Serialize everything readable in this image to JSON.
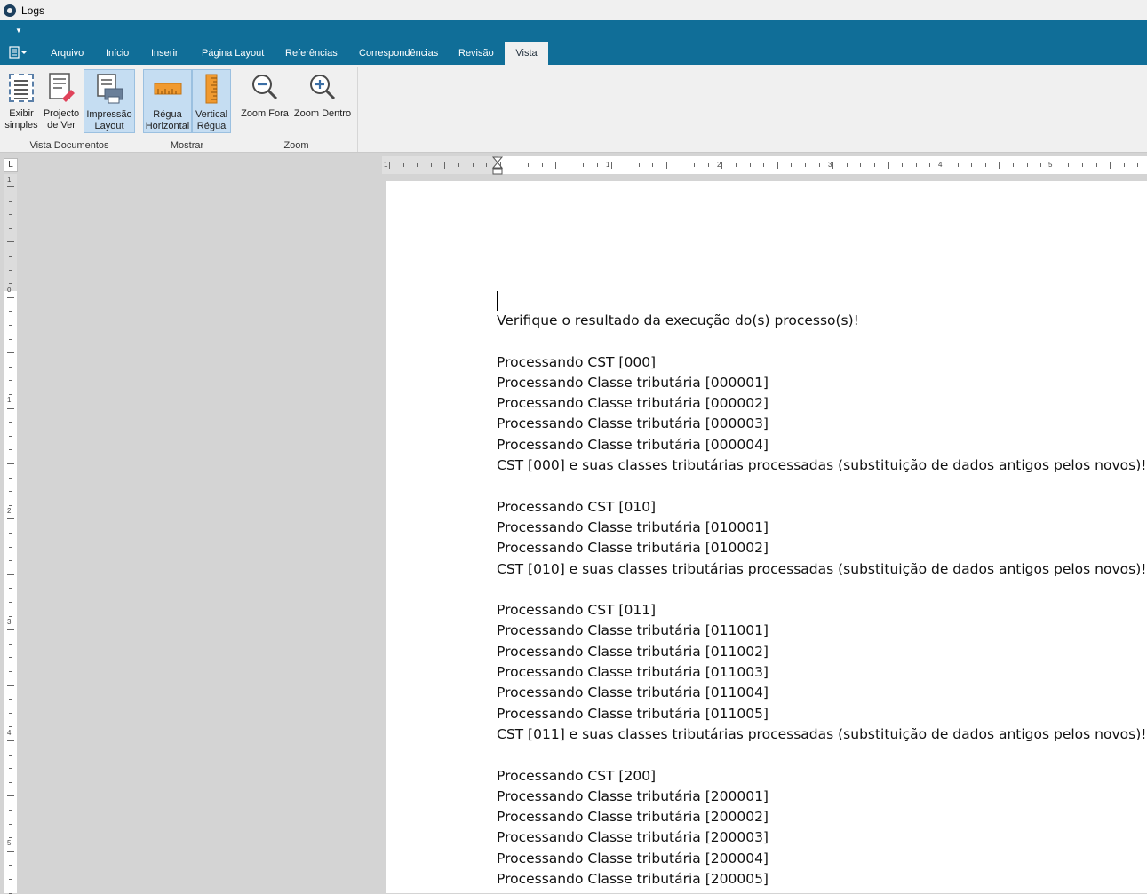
{
  "window": {
    "title": "Logs"
  },
  "ribbon": {
    "file_menu_icon": "document-menu-icon",
    "tabs": [
      {
        "label": "Arquivo",
        "active": false
      },
      {
        "label": "Início",
        "active": false
      },
      {
        "label": "Inserir",
        "active": false
      },
      {
        "label": "Página Layout",
        "active": false
      },
      {
        "label": "Referências",
        "active": false
      },
      {
        "label": "Correspondências",
        "active": false
      },
      {
        "label": "Revisão",
        "active": false
      },
      {
        "label": "Vista",
        "active": true
      }
    ],
    "groups": {
      "vista_documentos": {
        "label": "Vista Documentos",
        "buttons": [
          {
            "line1": "Exibir",
            "line2": "simples",
            "icon": "simple-view-icon",
            "pressed": false
          },
          {
            "line1": "Projecto",
            "line2": "de Ver",
            "icon": "draft-view-icon",
            "pressed": false
          },
          {
            "line1": "Impressão",
            "line2": "Layout",
            "icon": "print-layout-icon",
            "pressed": true
          }
        ]
      },
      "mostrar": {
        "label": "Mostrar",
        "buttons": [
          {
            "line1": "Régua",
            "line2": "Horizontal",
            "icon": "horizontal-ruler-icon",
            "pressed": true
          },
          {
            "line1": "Vertical",
            "line2": "Régua",
            "icon": "vertical-ruler-icon",
            "pressed": true
          }
        ]
      },
      "zoom": {
        "label": "Zoom",
        "buttons": [
          {
            "line1": "Zoom Fora",
            "icon": "zoom-out-icon"
          },
          {
            "line1": "Zoom Dentro",
            "icon": "zoom-in-icon"
          }
        ]
      }
    }
  },
  "rulers": {
    "corner_glyph": "L",
    "horizontal_numbers": [
      "1",
      "1",
      "2",
      "3",
      "4",
      "5"
    ],
    "vertical_numbers": [
      "1",
      "0",
      "1",
      "2",
      "3",
      "4",
      "5"
    ]
  },
  "document": {
    "lines": [
      "Verifique o resultado da execução do(s) processo(s)!",
      "",
      "Processando CST [000]",
      "Processando Classe tributária [000001]",
      "Processando Classe tributária [000002]",
      "Processando Classe tributária [000003]",
      "Processando Classe tributária [000004]",
      "CST [000] e suas classes tributárias processadas (substituição de dados antigos pelos novos)!",
      "",
      "Processando CST [010]",
      "Processando Classe tributária [010001]",
      "Processando Classe tributária [010002]",
      "CST [010] e suas classes tributárias processadas (substituição de dados antigos pelos novos)!",
      "",
      "Processando CST [011]",
      "Processando Classe tributária [011001]",
      "Processando Classe tributária [011002]",
      "Processando Classe tributária [011003]",
      "Processando Classe tributária [011004]",
      "Processando Classe tributária [011005]",
      "CST [011] e suas classes tributárias processadas (substituição de dados antigos pelos novos)!",
      "",
      "Processando CST [200]",
      "Processando Classe tributária [200001]",
      "Processando Classe tributária [200002]",
      "Processando Classe tributária [200003]",
      "Processando Classe tributária [200004]",
      "Processando Classe tributária [200005]"
    ]
  },
  "colors": {
    "ribbon_blue": "#106e98",
    "ribbon_body": "#f0f0f0",
    "pressed_button": "#c5ddf2",
    "workspace_gray": "#d4d4d4"
  }
}
